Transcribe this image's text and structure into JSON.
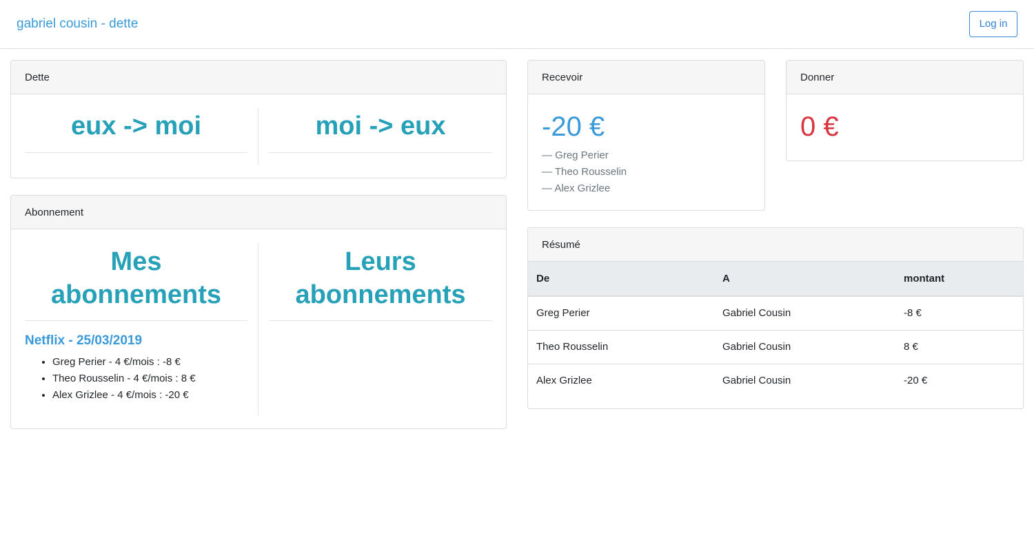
{
  "navbar": {
    "brand": "gabriel cousin - dette",
    "login_label": "Log in"
  },
  "dette": {
    "header": "Dette",
    "left_title": "eux -> moi",
    "right_title": "moi -> eux"
  },
  "abonnement": {
    "header": "Abonnement",
    "left_title": "Mes abonnements",
    "right_title": "Leurs abonnements",
    "subscriptions": [
      {
        "title": "Netflix - 25/03/2019",
        "items": [
          "Greg Perier - 4 €/mois : -8 €",
          "Theo Rousselin - 4 €/mois : 8 €",
          "Alex Grizlee - 4 €/mois : -20 €"
        ]
      }
    ]
  },
  "recevoir": {
    "header": "Recevoir",
    "amount": "-20 €",
    "people": [
      "— Greg Perier",
      "— Theo Rousselin",
      "— Alex Grizlee"
    ]
  },
  "donner": {
    "header": "Donner",
    "amount": "0 €"
  },
  "resume": {
    "header": "Résumé",
    "columns": [
      "De",
      "A",
      "montant"
    ],
    "rows": [
      [
        "Greg Perier",
        "Gabriel Cousin",
        "-8 €"
      ],
      [
        "Theo Rousselin",
        "Gabriel Cousin",
        "8 €"
      ],
      [
        "Alex Grizlee",
        "Gabriel Cousin",
        "-20 €"
      ]
    ]
  },
  "colors": {
    "brand": "#3a9ad9",
    "title_teal": "#26a1b7",
    "positive_blue": "#3a9ad9",
    "negative_red": "#d9343f"
  }
}
